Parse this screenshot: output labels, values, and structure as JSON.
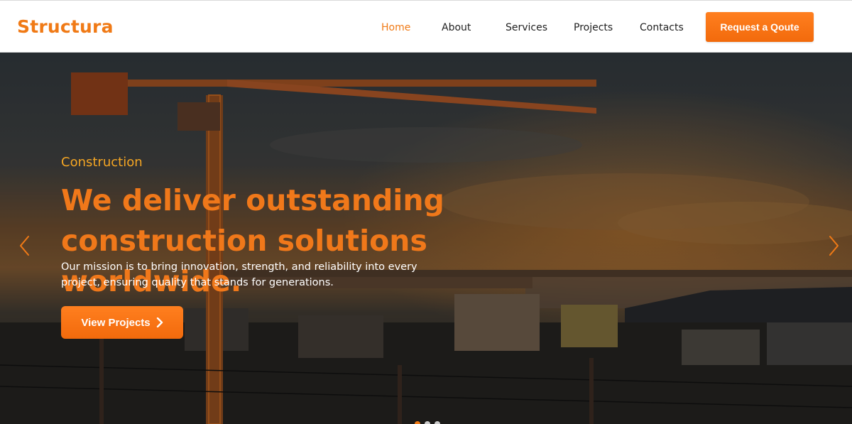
{
  "brand": {
    "name": "Structura",
    "color": "#f07a16"
  },
  "nav": {
    "items": [
      {
        "label": "Home",
        "active": true
      },
      {
        "label": "About",
        "active": false
      },
      {
        "label": "Services",
        "active": false
      },
      {
        "label": "Projects",
        "active": false
      },
      {
        "label": "Contacts",
        "active": false
      }
    ],
    "cta_label": "Request a Qoute"
  },
  "hero": {
    "eyebrow": "Construction",
    "title": "We deliver outstanding construction solutions worldwide.",
    "text": "Our mission is to bring innovation, strength, and reliability into every project, ensuring quality that stands for generations.",
    "button_label": "View Projects",
    "button_icon": "chevron-right-icon",
    "prev_icon": "chevron-left-icon",
    "next_icon": "chevron-right-icon",
    "slides": [
      {
        "active": true
      },
      {
        "active": false
      },
      {
        "active": false
      }
    ]
  },
  "colors": {
    "accent": "#f07a16",
    "eyebrow": "#f5a623"
  }
}
